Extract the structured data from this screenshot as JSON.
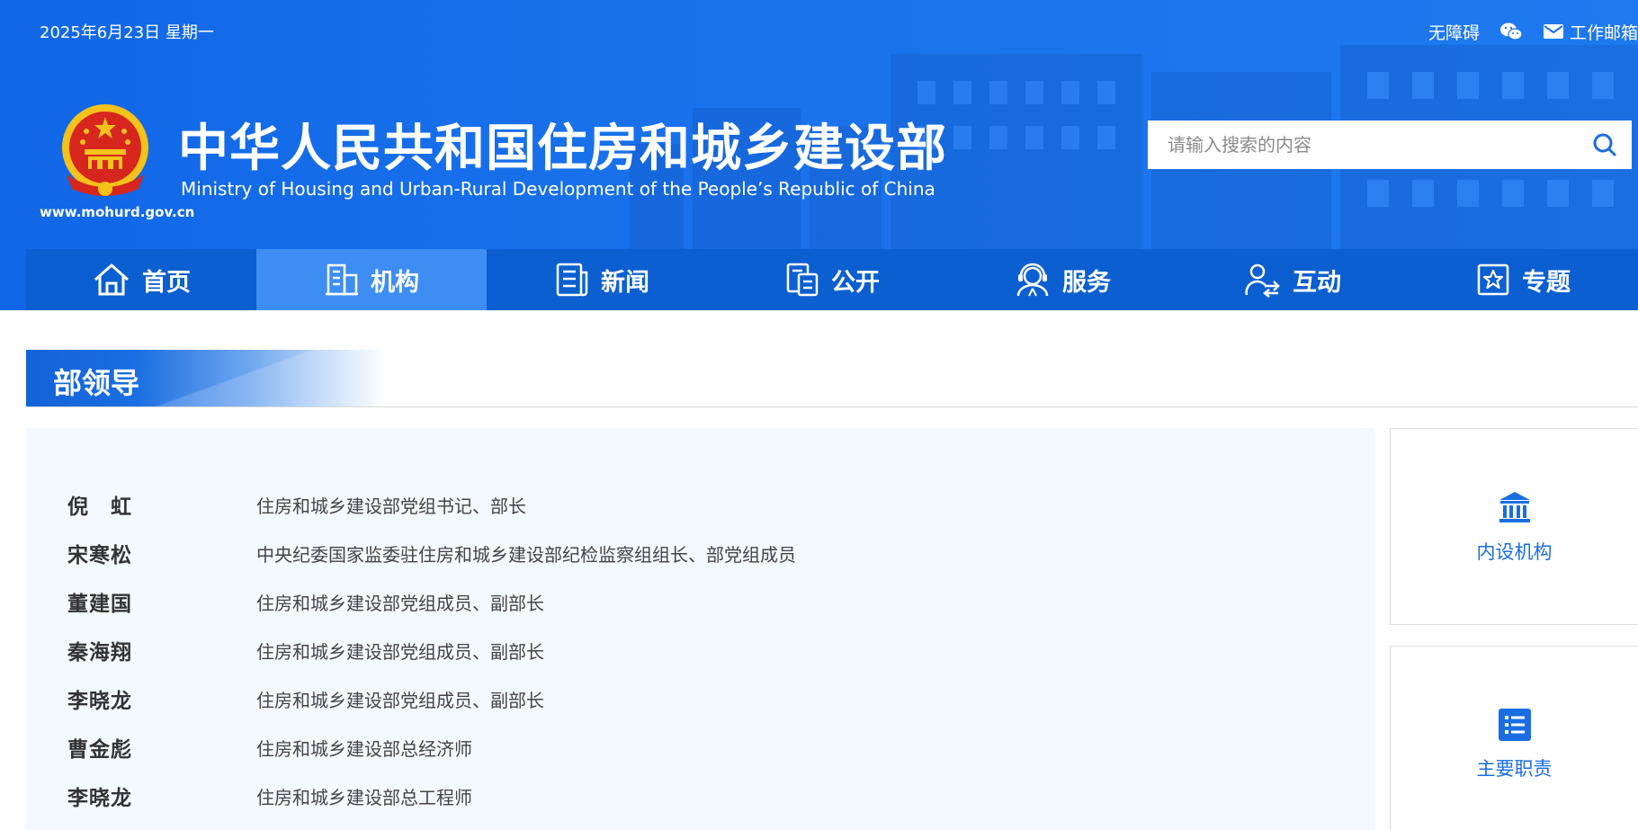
{
  "topbar": {
    "date": "2025年6月23日 星期一",
    "accessibility_label": "无障碍",
    "mail_label": "工作邮箱"
  },
  "site": {
    "title": "中华人民共和国住房和城乡建设部",
    "subtitle": "Ministry of Housing and Urban-Rural Development of the People’s Republic of China",
    "url": "www.mohurd.gov.cn"
  },
  "search": {
    "placeholder": "请输入搜索的内容",
    "value": ""
  },
  "nav": {
    "items": [
      {
        "label": "首页",
        "icon": "home-icon",
        "active": false
      },
      {
        "label": "机构",
        "icon": "building-icon",
        "active": true
      },
      {
        "label": "新闻",
        "icon": "newspaper-icon",
        "active": false
      },
      {
        "label": "公开",
        "icon": "document-icon",
        "active": false
      },
      {
        "label": "服务",
        "icon": "service-agent-icon",
        "active": false
      },
      {
        "label": "互动",
        "icon": "interaction-icon",
        "active": false
      },
      {
        "label": "专题",
        "icon": "star-badge-icon",
        "active": false
      }
    ]
  },
  "section": {
    "title": "部领导"
  },
  "leaders": [
    {
      "name": "倪　虹",
      "title": "住房和城乡建设部党组书记、部长"
    },
    {
      "name": "宋寒松",
      "title": "中央纪委国家监委驻住房和城乡建设部纪检监察组组长、部党组成员"
    },
    {
      "name": "董建国",
      "title": "住房和城乡建设部党组成员、副部长"
    },
    {
      "name": "秦海翔",
      "title": "住房和城乡建设部党组成员、副部长"
    },
    {
      "name": "李晓龙",
      "title": "住房和城乡建设部党组成员、副部长"
    },
    {
      "name": "曹金彪",
      "title": "住房和城乡建设部总经济师"
    },
    {
      "name": "李晓龙",
      "title": "住房和城乡建设部总工程师"
    }
  ],
  "side": {
    "cards": [
      {
        "label": "内设机构",
        "icon": "institution-icon"
      },
      {
        "label": "主要职责",
        "icon": "list-icon"
      }
    ]
  },
  "colors": {
    "brand_blue": "#1167e6",
    "nav_blue": "#0c5fd0",
    "nav_active": "#3d8df3",
    "link_blue": "#1a6ee2",
    "panel_bg": "#f4f8ff"
  }
}
